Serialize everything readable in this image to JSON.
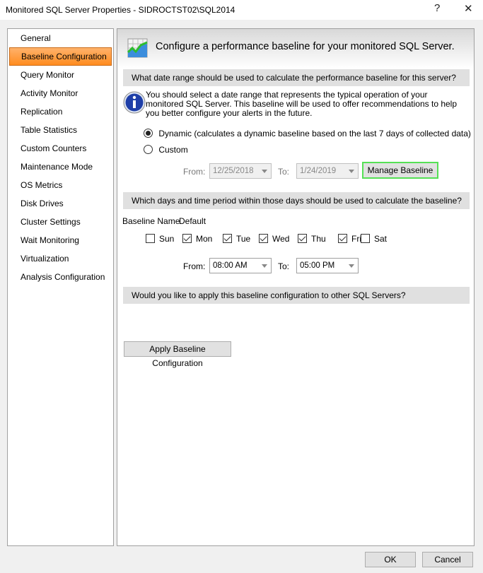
{
  "window": {
    "title": "Monitored SQL Server Properties - SIDROCTST02\\SQL2014",
    "help": "?",
    "close": "✕"
  },
  "sidebar": {
    "items": [
      {
        "label": "General",
        "selected": false
      },
      {
        "label": "Baseline Configuration",
        "selected": true
      },
      {
        "label": "Query Monitor",
        "selected": false
      },
      {
        "label": "Activity Monitor",
        "selected": false
      },
      {
        "label": "Replication",
        "selected": false
      },
      {
        "label": "Table Statistics",
        "selected": false
      },
      {
        "label": "Custom Counters",
        "selected": false
      },
      {
        "label": "Maintenance Mode",
        "selected": false
      },
      {
        "label": "OS Metrics",
        "selected": false
      },
      {
        "label": "Disk Drives",
        "selected": false
      },
      {
        "label": "Cluster Settings",
        "selected": false
      },
      {
        "label": "Wait Monitoring",
        "selected": false
      },
      {
        "label": "Virtualization",
        "selected": false
      },
      {
        "label": "Analysis Configuration",
        "selected": false
      }
    ]
  },
  "main": {
    "header": "Configure a performance baseline for your monitored SQL Server.",
    "date_section": "What date range should be used to calculate the performance baseline for this server?",
    "info_text": "You should select a date range that represents the typical operation of your monitored SQL Server. This baseline will be used to offer recommendations to help you better configure your alerts in the future.",
    "dynamic_label": "Dynamic (calculates a dynamic baseline based on the last 7 days of collected data)",
    "custom_label": "Custom",
    "mode": "Dynamic",
    "from_label": "From:",
    "from_date": "12/25/2018",
    "to_label": "To:",
    "to_date": "1/24/2019",
    "manage_baseline": "Manage Baseline",
    "days_section": "Which days and time period within those days should be used to calculate the baseline?",
    "baseline_name_label": "Baseline Name",
    "baseline_name": "Default",
    "days": [
      {
        "label": "Sun",
        "checked": false
      },
      {
        "label": "Mon",
        "checked": true
      },
      {
        "label": "Tue",
        "checked": true
      },
      {
        "label": "Wed",
        "checked": true
      },
      {
        "label": "Thu",
        "checked": true
      },
      {
        "label": "Fri",
        "checked": true
      },
      {
        "label": "Sat",
        "checked": false
      }
    ],
    "time_from_label": "From:",
    "time_from": "08:00 AM",
    "time_to_label": "To:",
    "time_to": "05:00 PM",
    "apply_section": "Would you like to apply this baseline configuration to other SQL Servers?",
    "apply_button": "Apply Baseline Configuration"
  },
  "footer": {
    "ok": "OK",
    "cancel": "Cancel"
  },
  "colors": {
    "selected_nav": "#ff9a3c",
    "highlight_border": "#55e055"
  }
}
